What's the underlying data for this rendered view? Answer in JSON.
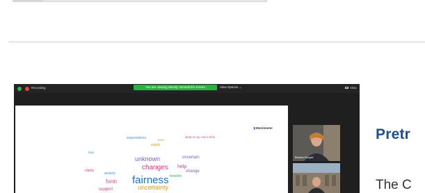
{
  "zoom": {
    "recording_label": "Recording",
    "viewing_banner": "You are viewing Wendy Venverloh's screen",
    "view_options_label": "View Options ⌄",
    "view_label": "View",
    "participants": [
      {
        "name": "Bradan Buoyet"
      },
      {
        "name": ""
      }
    ]
  },
  "shared_screen": {
    "brand": "Mentimeter",
    "word_cloud": [
      {
        "text": "fairness",
        "color": "#1c6fd1"
      },
      {
        "text": "changes",
        "color": "#e0357a"
      },
      {
        "text": "unknown",
        "color": "#7a5cc4"
      },
      {
        "text": "uncertainty",
        "color": "#d99b1f"
      },
      {
        "text": "help",
        "color": "#e0357a"
      },
      {
        "text": "process",
        "color": "#d99b1f"
      },
      {
        "text": "expectations",
        "color": "#4a8fd8"
      },
      {
        "text": "what is my role in this",
        "color": "#c94f8a"
      },
      {
        "text": "form",
        "color": "#c94f8a"
      },
      {
        "text": "anxiety",
        "color": "#4a8fd8"
      },
      {
        "text": "equity",
        "color": "#d99b1f"
      },
      {
        "text": "uncertain",
        "color": "#7a5cc4"
      },
      {
        "text": "timeline",
        "color": "#4aa86a"
      },
      {
        "text": "clarity",
        "color": "#e0357a"
      },
      {
        "text": "bias",
        "color": "#4a8fd8"
      },
      {
        "text": "trust",
        "color": "#d99b1f"
      },
      {
        "text": "change",
        "color": "#7a5cc4"
      },
      {
        "text": "support",
        "color": "#e0357a"
      }
    ]
  },
  "slide": {
    "title_partial": "Pretr",
    "body_partial": "The C"
  },
  "colors": {
    "zoom_bg": "#1f1f1f",
    "banner_green": "#27b33f",
    "title_blue": "#1f4e96"
  }
}
